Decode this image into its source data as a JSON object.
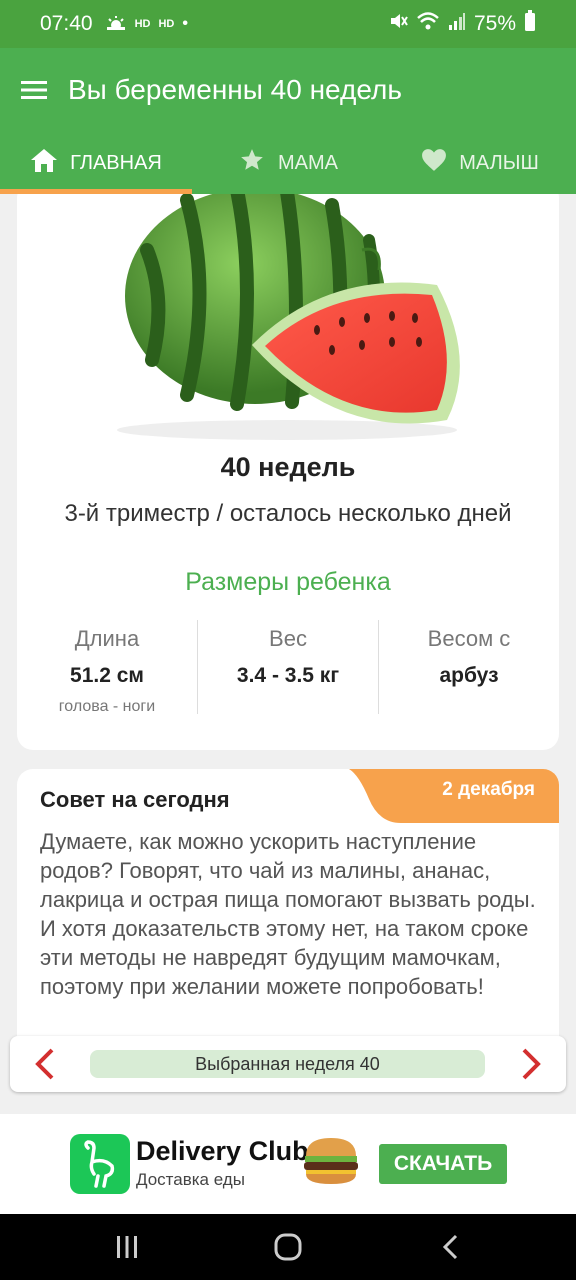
{
  "status": {
    "time": "07:40",
    "hd1": "HD",
    "hd2": "HD",
    "dot": "•",
    "battery": "75%"
  },
  "appbar": {
    "title": "Вы беременны 40 недель",
    "menu_icon": "menu-icon"
  },
  "tabs": [
    {
      "label": "ГЛАВНАЯ",
      "icon": "home-icon",
      "active": true
    },
    {
      "label": "МАМА",
      "icon": "star-icon"
    },
    {
      "label": "МАЛЫШ",
      "icon": "heart-icon"
    }
  ],
  "week_card": {
    "weeks": "40 недель",
    "trimester": "3-й триместр / осталось несколько дней",
    "sizes_title": "Размеры ребенка",
    "stats": [
      {
        "label": "Длина",
        "value": "51.2 см",
        "sub": "голова - ноги"
      },
      {
        "label": "Вес",
        "value": "3.4 - 3.5 кг",
        "sub": ""
      },
      {
        "label": "Весом с",
        "value": "арбуз",
        "sub": ""
      }
    ]
  },
  "tip": {
    "title": "Совет на сегодня",
    "date": "2 декабря",
    "text": "Думаете, как можно ускорить наступление родов? Говорят, что чай из малины, ананас, лакрица и острая пища помогают вызвать роды. И хотя доказательств этому нет, на таком сроке эти методы не навредят будущим мамочкам, поэтому при желании можете попробовать!"
  },
  "week_selector": {
    "label": "Выбранная неделя 40"
  },
  "ad": {
    "brand": "Delivery Club",
    "slogan": "Доставка еды",
    "button": "СКАЧАТЬ"
  },
  "colors": {
    "primary": "#4caf50",
    "status_bar": "#4aa33f",
    "accent": "#f7a24c",
    "nav_arrow": "#d32f2f"
  }
}
